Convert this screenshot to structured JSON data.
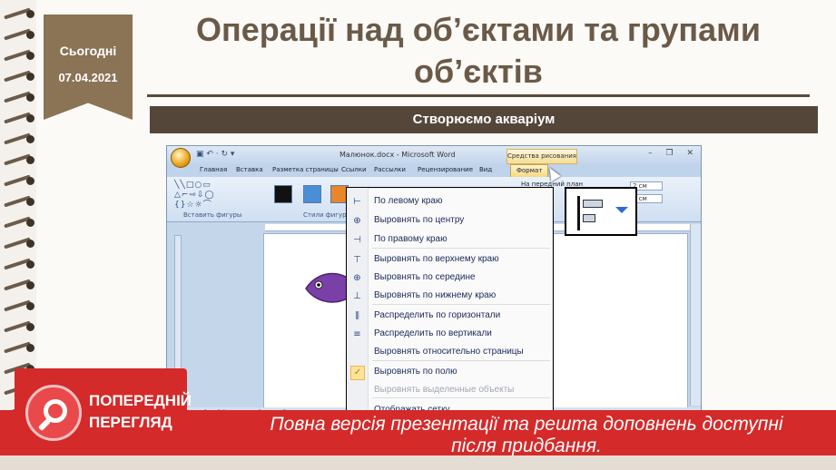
{
  "slide": {
    "date_label": "Сьогодні",
    "date_value": "07.04.2021",
    "title": "Операції над об’єктами та групами об’єктів",
    "subtitle": "Створюємо акваріум"
  },
  "word_window": {
    "doc_title": "Малюнок.docx - Microsoft Word",
    "context_tools": "Средства рисования",
    "quick_access": "▣ ↶ · ↻ ▾",
    "window_controls": "– ❐ ✕",
    "tabs": [
      "Главная",
      "Вставка",
      "Разметка страницы",
      "Ссылки",
      "Рассылки",
      "Рецензирование",
      "Вид",
      "Формат"
    ],
    "active_tab": "Формат",
    "ribbon_groups": {
      "insert_shapes": "Вставить фигуры",
      "shape_styles": "Стили фигур"
    },
    "ribbon_items": {
      "front_plane": "На передний план",
      "size_value_1": "2 см",
      "size_value_2": "2 см"
    },
    "shapes_glyphs": "╲╲□○▭\n△⌐⇨⇩◯\n{}☆☼⌒",
    "status_text": "Страница: 1 из 1    Число слов: 0    русский"
  },
  "align_menu": {
    "items": [
      {
        "label": "По левому краю",
        "icon": "align-left-icon",
        "glyph": "⊢",
        "disabled": false,
        "checked": false
      },
      {
        "label": "Выровнять по центру",
        "icon": "align-center-icon",
        "glyph": "⊕",
        "disabled": false,
        "checked": false
      },
      {
        "label": "По правому краю",
        "icon": "align-right-icon",
        "glyph": "⊣",
        "disabled": false,
        "checked": false
      },
      {
        "label": "Выровнять по верхнему краю",
        "icon": "align-top-icon",
        "glyph": "⊤",
        "disabled": false,
        "checked": false
      },
      {
        "label": "Выровнять по середине",
        "icon": "align-middle-icon",
        "glyph": "⊕",
        "disabled": false,
        "checked": false
      },
      {
        "label": "Выровнять по нижнему краю",
        "icon": "align-bottom-icon",
        "glyph": "⊥",
        "disabled": false,
        "checked": false
      },
      {
        "label": "Распределить по горизонтали",
        "icon": "distribute-horizontal-icon",
        "glyph": "⫼",
        "disabled": false,
        "checked": false
      },
      {
        "label": "Распределить по вертикали",
        "icon": "distribute-vertical-icon",
        "glyph": "≡",
        "disabled": false,
        "checked": false
      },
      {
        "label": "Выровнять относительно страницы",
        "icon": "",
        "glyph": "",
        "disabled": false,
        "checked": false
      },
      {
        "label": "Выровнять по полю",
        "icon": "checkmark-icon",
        "glyph": "✓",
        "disabled": false,
        "checked": true
      },
      {
        "label": "Выровнять выделенные объекты",
        "icon": "",
        "glyph": "",
        "disabled": true,
        "checked": false
      },
      {
        "label": "Отображать сетку",
        "icon": "",
        "glyph": "",
        "disabled": false,
        "checked": false
      }
    ]
  },
  "preview": {
    "badge_line1": "ПОПЕРЕДНІЙ",
    "badge_line2": "ПЕРЕГЛЯД",
    "banner_text": "Повна версія презентації та решта доповнень доступні після придбання."
  },
  "colors": {
    "brown": "#8b7355",
    "dark_bar": "#55463a",
    "banner_red": "#d42a2a",
    "fish_purple": "#7b3fa8"
  }
}
